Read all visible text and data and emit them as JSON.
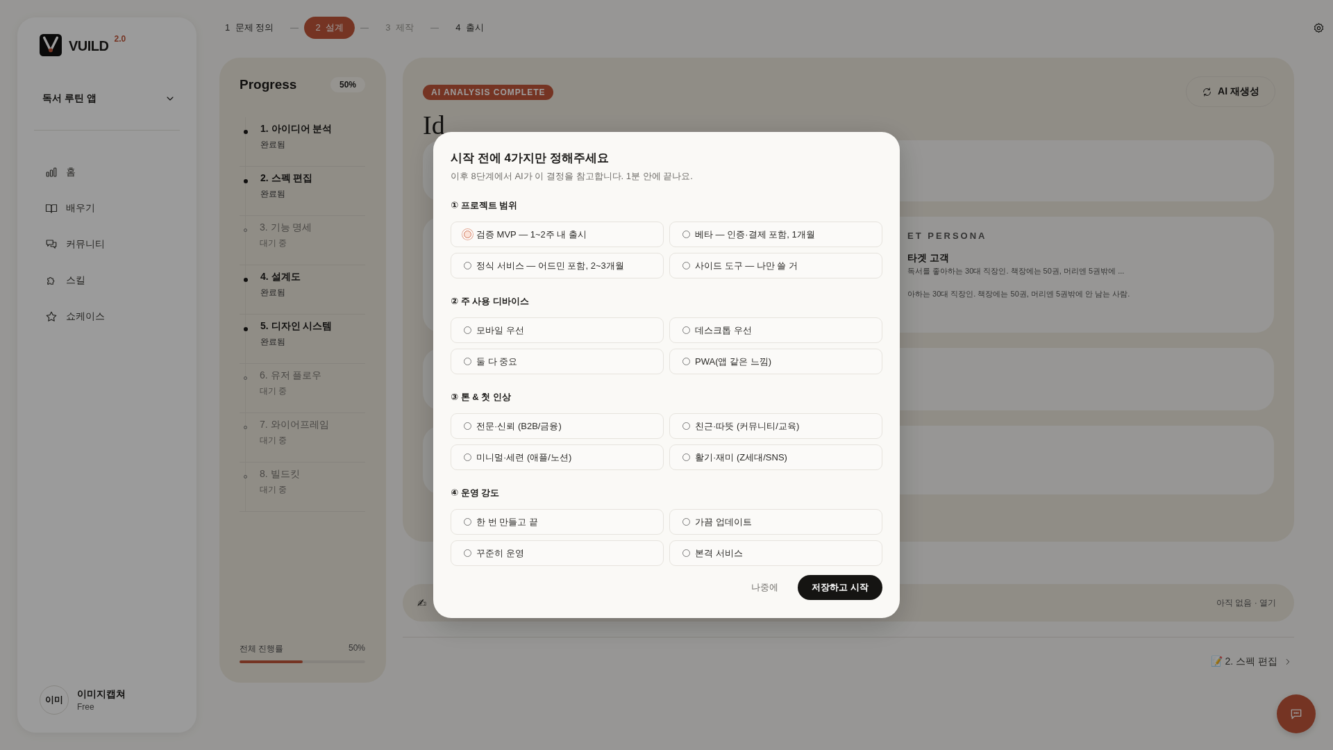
{
  "sidebar": {
    "logo": "VUILD",
    "version": "2.0",
    "project": "독서 루틴 앱",
    "nav": [
      {
        "label": "홈"
      },
      {
        "label": "배우기"
      },
      {
        "label": "커뮤니티"
      },
      {
        "label": "스킬"
      },
      {
        "label": "쇼케이스"
      }
    ],
    "user": {
      "avatar": "이미",
      "name": "이미지캡쳐",
      "plan": "Free"
    }
  },
  "stepper": [
    {
      "number": "1",
      "label": "문제 정의",
      "selected": false,
      "disabled": false
    },
    {
      "number": "2",
      "label": "설계",
      "selected": true,
      "disabled": false
    },
    {
      "number": "3",
      "label": "제작",
      "selected": false,
      "disabled": true
    },
    {
      "number": "4",
      "label": "출시",
      "selected": false,
      "disabled": false
    }
  ],
  "progress": {
    "title": "Progress",
    "badge": "50%",
    "steps": [
      {
        "title": "1. 아이디어 분석",
        "status": "완료됨",
        "done": true
      },
      {
        "title": "2. 스펙 편집",
        "status": "완료됨",
        "done": true
      },
      {
        "title": "3. 기능 명세",
        "status": "대기 중",
        "done": false
      },
      {
        "title": "4. 설계도",
        "status": "완료됨",
        "done": true
      },
      {
        "title": "5. 디자인 시스템",
        "status": "완료됨",
        "done": true
      },
      {
        "title": "6. 유저 플로우",
        "status": "대기 중",
        "done": false
      },
      {
        "title": "7. 와이어프레임",
        "status": "대기 중",
        "done": false
      },
      {
        "title": "8. 빌드킷",
        "status": "대기 중",
        "done": false
      }
    ],
    "overall_label": "전체 진행률",
    "overall_value": "50%",
    "level": 0.5
  },
  "main": {
    "badge": "AI ANALYSIS COMPLETE",
    "regenerate": "AI 재생성",
    "heading": "Id",
    "cards": [
      {
        "kind": "empty"
      },
      {
        "kind": "persona",
        "label": "ET PERSONA",
        "title": "타겟 고객",
        "summary": "독서를 좋아하는 30대 직장인. 책장에는 50권, 머리엔 5권밖에 ...",
        "detail": "아하는 30대 직장인. 책장에는 50권, 머리엔 5권밖에 안 남는 사람."
      },
      {
        "kind": "empty"
      },
      {
        "kind": "empty"
      }
    ],
    "bottom_bar": {
      "emoji": "✍",
      "link": "아직 없음 · 열기"
    },
    "next": "📝 2. 스펙 편집"
  },
  "dialog": {
    "title": "시작 전에 4가지만 정해주세요",
    "subtitle": "이후 8단계에서 AI가 이 결정을 참고합니다. 1분 안에 끝나요.",
    "sections": [
      {
        "label": "① 프로젝트 범위",
        "options": [
          {
            "label": "검증 MVP — 1~2주 내 출시",
            "selected": false,
            "focused": true
          },
          {
            "label": "베타 — 인증·결제 포함, 1개월",
            "selected": false,
            "focused": false
          },
          {
            "label": "정식 서비스 — 어드민 포함, 2~3개월",
            "selected": false,
            "focused": false
          },
          {
            "label": "사이드 도구 — 나만 쓸 거",
            "selected": false,
            "focused": false
          }
        ]
      },
      {
        "label": "② 주 사용 디바이스",
        "options": [
          {
            "label": "모바일 우선",
            "selected": false,
            "focused": false
          },
          {
            "label": "데스크톱 우선",
            "selected": false,
            "focused": false
          },
          {
            "label": "둘 다 중요",
            "selected": false,
            "focused": false
          },
          {
            "label": "PWA(앱 같은 느낌)",
            "selected": false,
            "focused": false
          }
        ]
      },
      {
        "label": "③ 톤 & 첫 인상",
        "options": [
          {
            "label": "전문·신뢰 (B2B/금융)",
            "selected": false,
            "focused": false
          },
          {
            "label": "친근·따뜻 (커뮤니티/교육)",
            "selected": false,
            "focused": false
          },
          {
            "label": "미니멀·세련 (애플/노션)",
            "selected": false,
            "focused": false
          },
          {
            "label": "활기·재미 (Z세대/SNS)",
            "selected": false,
            "focused": false
          }
        ]
      },
      {
        "label": "④ 운영 강도",
        "options": [
          {
            "label": "한 번 만들고 끝",
            "selected": false,
            "focused": false
          },
          {
            "label": "가끔 업데이트",
            "selected": false,
            "focused": false
          },
          {
            "label": "꾸준히 운영",
            "selected": false,
            "focused": false
          },
          {
            "label": "본격 서비스",
            "selected": false,
            "focused": false
          }
        ]
      }
    ],
    "later": "나중에",
    "submit": "저장하고 시작"
  }
}
